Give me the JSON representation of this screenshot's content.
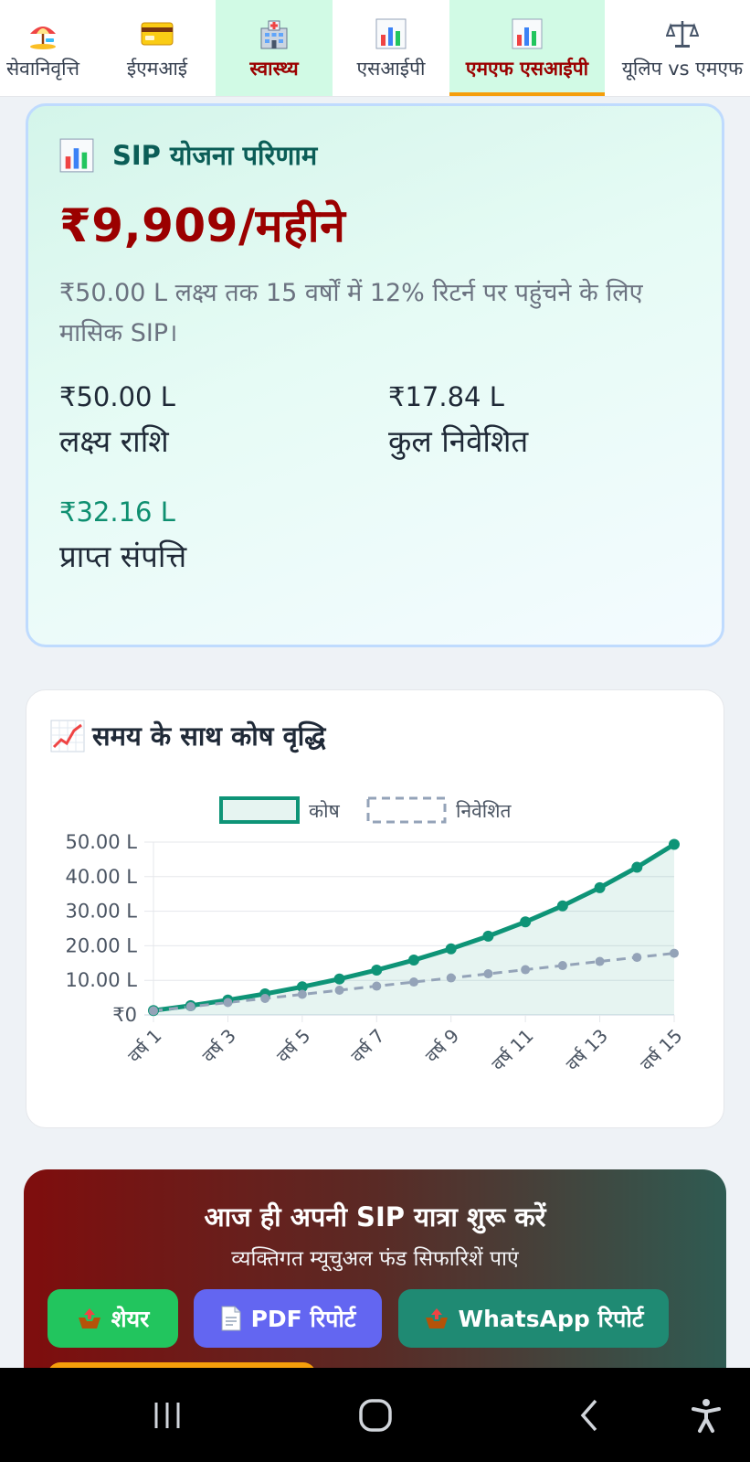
{
  "tabs": [
    {
      "label": "सेवानिवृत्ति",
      "icon": "beach-umbrella-icon"
    },
    {
      "label": "ईएमआई",
      "icon": "credit-card-icon"
    },
    {
      "label": "स्वास्थ्य",
      "icon": "hospital-icon",
      "highlighted": true
    },
    {
      "label": "एसआईपी",
      "icon": "bar-chart-icon"
    },
    {
      "label": "एमएफ एसआईपी",
      "icon": "bar-chart-icon",
      "active": true
    },
    {
      "label": "यूलिप vs एमएफ",
      "icon": "balance-scale-icon"
    }
  ],
  "result": {
    "title": "SIP योजना परिणाम",
    "amount": "₹9,909/महीने",
    "description": "₹50.00 L लक्ष्य तक 15 वर्षों में 12% रिटर्न पर पहुंचने के लिए मासिक SIP।",
    "stats": [
      {
        "value": "₹50.00 L",
        "label": "लक्ष्य राशि"
      },
      {
        "value": "₹17.84 L",
        "label": "कुल निवेशित"
      },
      {
        "value": "₹32.16 L",
        "label": "प्राप्त संपत्ति"
      }
    ]
  },
  "chart_section": {
    "title": "समय के साथ कोष वृद्धि"
  },
  "chart_data": {
    "type": "line",
    "categories": [
      "वर्ष 1",
      "वर्ष 2",
      "वर्ष 3",
      "वर्ष 4",
      "वर्ष 5",
      "वर्ष 6",
      "वर्ष 7",
      "वर्ष 8",
      "वर्ष 9",
      "वर्ष 10",
      "वर्ष 11",
      "वर्ष 12",
      "वर्ष 13",
      "वर्ष 14",
      "वर्ष 15"
    ],
    "x_tick_labels": [
      "वर्ष 1",
      "वर्ष 3",
      "वर्ष 5",
      "वर्ष 7",
      "वर्ष 9",
      "वर्ष 11",
      "वर्ष 13",
      "वर्ष 15"
    ],
    "series": [
      {
        "name": "कोष",
        "values": [
          1.27,
          2.69,
          4.29,
          6.09,
          8.12,
          10.4,
          12.97,
          15.86,
          19.12,
          22.78,
          26.91,
          31.56,
          36.81,
          42.71,
          49.35
        ],
        "color": "#0e9477",
        "style": "solid",
        "filled": true
      },
      {
        "name": "निवेशित",
        "values": [
          1.19,
          2.38,
          3.57,
          4.76,
          5.95,
          7.14,
          8.32,
          9.51,
          10.7,
          11.89,
          13.08,
          14.27,
          15.46,
          16.65,
          17.84
        ],
        "color": "#94a3b8",
        "style": "dashed",
        "filled": false
      }
    ],
    "y_ticks": [
      "₹0",
      "10.00 L",
      "20.00 L",
      "30.00 L",
      "40.00 L",
      "50.00 L"
    ],
    "ylim": [
      0,
      50
    ],
    "grid": true,
    "legend_position": "top-center"
  },
  "cta": {
    "title": "आज ही अपनी SIP यात्रा शुरू करें",
    "subtitle": "व्यक्तिगत म्यूचुअल फंड सिफारिशें पाएं",
    "buttons": [
      {
        "label": "शेयर",
        "icon": "outbox-tray-icon"
      },
      {
        "label": "PDF रिपोर्ट",
        "icon": "document-icon"
      },
      {
        "label": "WhatsApp रिपोर्ट",
        "icon": "outbox-tray-icon"
      }
    ]
  },
  "colors": {
    "brand_red": "#9b0000",
    "teal": "#0e9477",
    "accent_orange": "#f59e0b"
  }
}
